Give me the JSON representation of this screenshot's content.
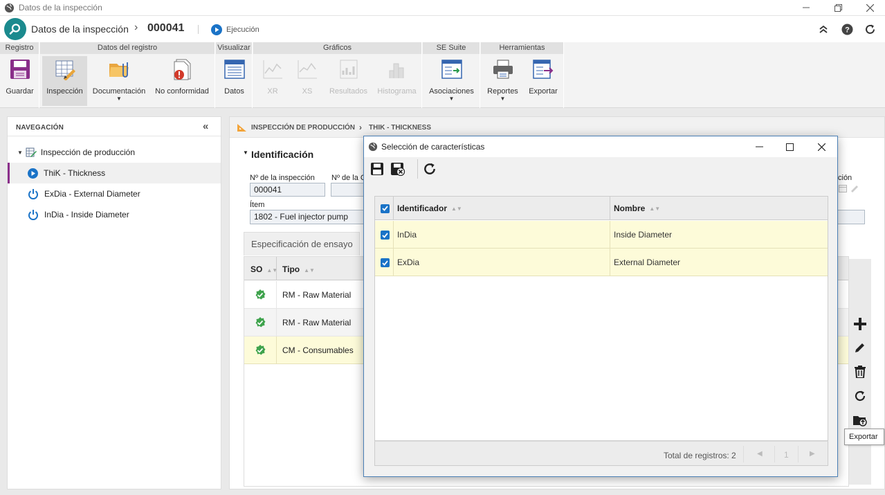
{
  "window": {
    "title": "Datos de la inspección"
  },
  "header": {
    "title": "Datos de la inspección",
    "separator": "›",
    "record_id": "000041",
    "status": "Ejecución"
  },
  "ribbon": {
    "groups": {
      "registro": "Registro",
      "datos_registro": "Datos del registro",
      "visualizar": "Visualizar",
      "graficos": "Gráficos",
      "se_suite": "SE Suite",
      "herramientas": "Herramientas"
    },
    "buttons": {
      "guardar": "Guardar",
      "inspeccion": "Inspección",
      "documentacion": "Documentación",
      "no_conformidad": "No conformidad",
      "datos": "Datos",
      "xr": "XR",
      "xs": "XS",
      "resultados": "Resultados",
      "histograma": "Histograma",
      "asociaciones": "Asociaciones",
      "reportes": "Reportes",
      "exportar": "Exportar"
    }
  },
  "nav": {
    "title": "NAVEGACIÓN",
    "root": "Inspección de producción",
    "items": [
      {
        "label": "ThiK - Thickness",
        "status": "running"
      },
      {
        "label": "ExDia - External Diameter",
        "status": "power"
      },
      {
        "label": "InDia - Inside Diameter",
        "status": "power"
      }
    ]
  },
  "breadcrumb": {
    "first": "INSPECCIÓN DE PRODUCCIÓN",
    "second": "THIK - THICKNESS"
  },
  "section": {
    "title": "Identificación"
  },
  "form": {
    "inspection_no_label": "Nº de la inspección",
    "inspection_no_value": "000041",
    "second_label": "Nº de la C",
    "right_label": "ción",
    "item_label": "Ítem",
    "item_value": "1802 - Fuel injector pump"
  },
  "tabs": {
    "active": "Especificación de ensayo"
  },
  "grid": {
    "headers": {
      "so": "SO",
      "tipo": "Tipo"
    },
    "rows": [
      {
        "tipo": "RM - Raw Material"
      },
      {
        "tipo": "RM - Raw Material"
      },
      {
        "tipo": "CM - Consumables"
      }
    ]
  },
  "tooltip": {
    "exportar": "Exportar"
  },
  "dialog": {
    "title": "Selección de características",
    "columns": {
      "identificador": "Identificador",
      "nombre": "Nombre"
    },
    "rows": [
      {
        "identificador": "InDia",
        "nombre": "Inside Diameter"
      },
      {
        "identificador": "ExDia",
        "nombre": "External Diameter"
      }
    ],
    "footer": {
      "total": "Total de registros: 2",
      "page": "1"
    }
  },
  "colors": {
    "accent": "#1a73c7",
    "teal": "#1b8a8e",
    "selected_row": "#fdfbd9",
    "ok_green": "#3fa34d"
  }
}
